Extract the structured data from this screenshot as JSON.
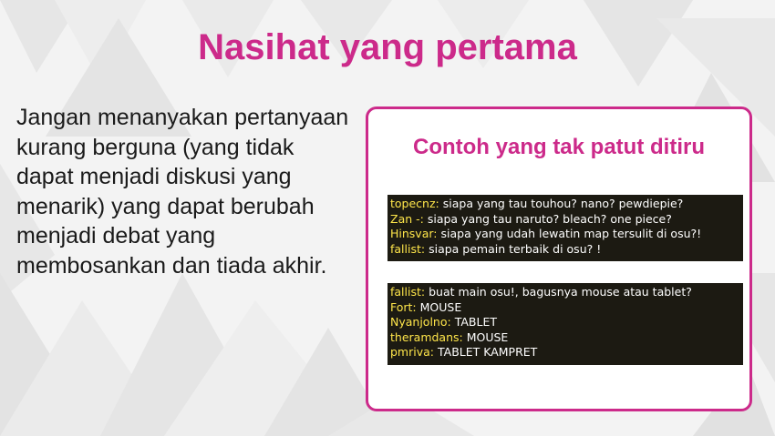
{
  "slide": {
    "title": "Nasihat yang pertama",
    "body": "Jangan menanyakan pertanyaan kurang berguna (yang tidak dapat menjadi diskusi yang menarik) yang dapat berubah menjadi debat yang membosankan dan tiada akhir.",
    "example_title": "Contoh yang tak patut ditiru"
  },
  "chat_log_1": [
    {
      "user": "topecnz:",
      "message": "siapa yang tau touhou? nano? pewdiepie?"
    },
    {
      "user": "Zan -:",
      "message": "siapa yang tau naruto? bleach? one piece?"
    },
    {
      "user": "Hinsvar:",
      "message": "siapa yang udah lewatin map tersulit di osu?!"
    },
    {
      "user": "fallist:",
      "message": "siapa pemain terbaik di osu? !"
    }
  ],
  "chat_log_2": [
    {
      "user": "fallist:",
      "message": "buat main osu!, bagusnya mouse atau tablet?"
    },
    {
      "user": "Fort:",
      "message": "MOUSE"
    },
    {
      "user": "Nyanjolno:",
      "message": "TABLET"
    },
    {
      "user": "theramdans:",
      "message": "MOUSE"
    },
    {
      "user": "pmriva:",
      "message": "TABLET KAMPRET"
    }
  ],
  "colors": {
    "accent": "#cc2a8a",
    "chat_background": "#1c1a12",
    "chat_username": "#ffe64a",
    "chat_text": "#ffffff"
  }
}
